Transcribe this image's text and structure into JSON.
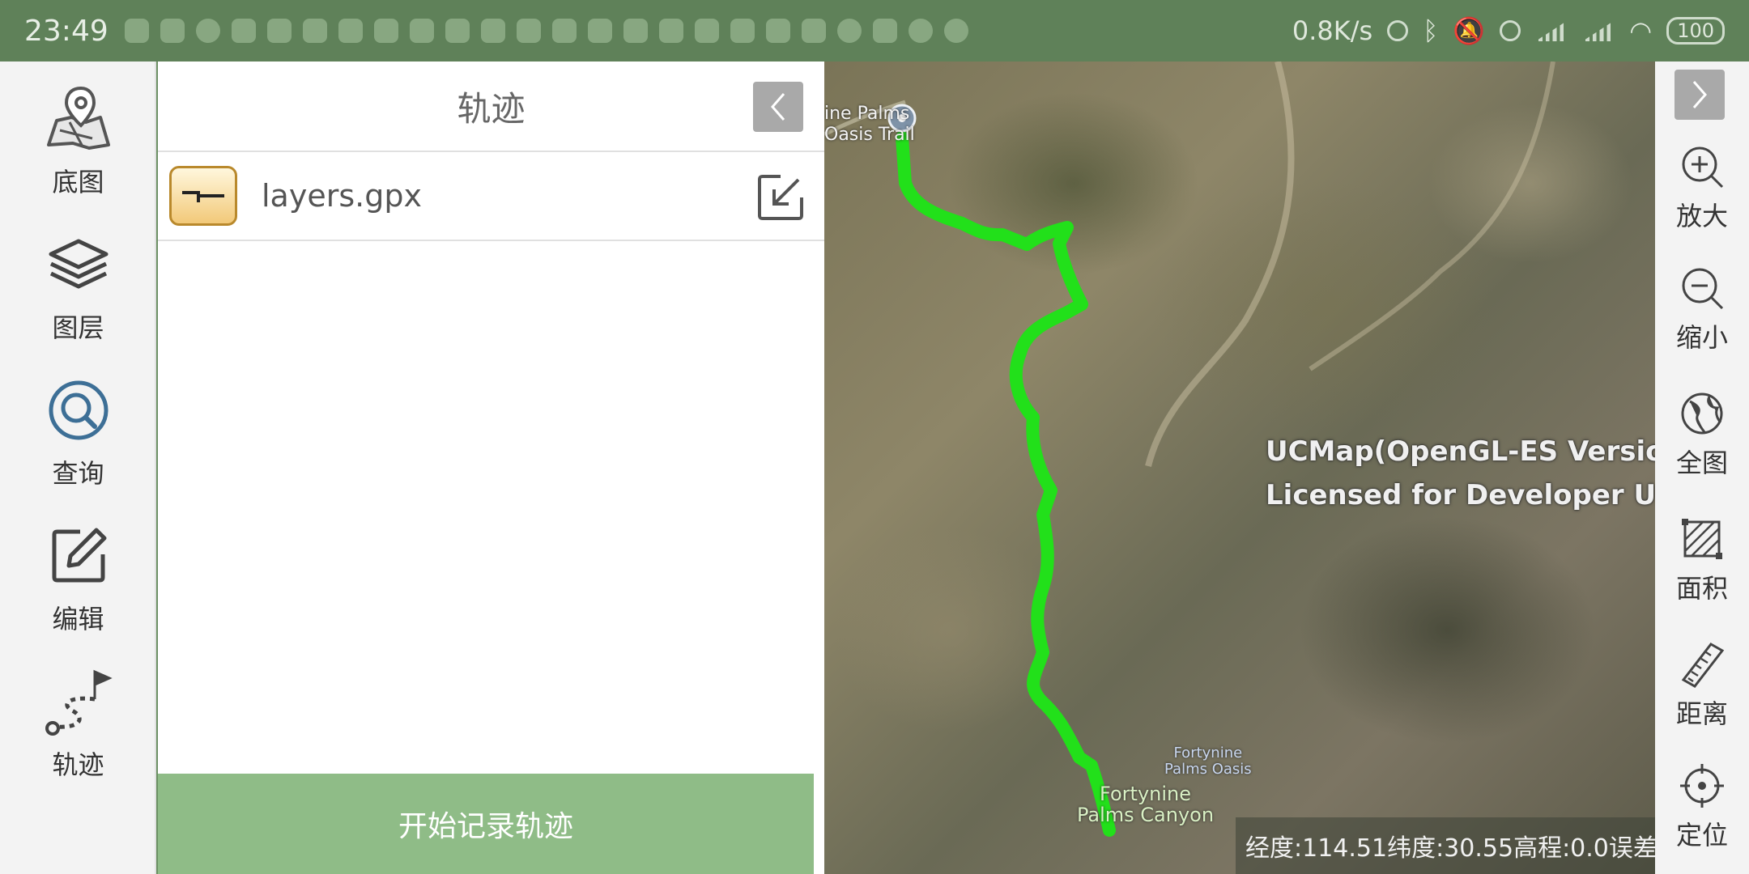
{
  "status_bar": {
    "time": "23:49",
    "speed": "0.8K/s",
    "battery": "100"
  },
  "left_nav": {
    "items": [
      {
        "label": "底图",
        "icon": "map-pin-icon"
      },
      {
        "label": "图层",
        "icon": "layers-icon"
      },
      {
        "label": "查询",
        "icon": "search-icon"
      },
      {
        "label": "编辑",
        "icon": "edit-icon"
      },
      {
        "label": "轨迹",
        "icon": "track-icon"
      }
    ]
  },
  "panel": {
    "title": "轨迹",
    "file": {
      "name": "layers.gpx"
    },
    "record_button": "开始记录轨迹"
  },
  "map": {
    "watermark_line1": "UCMap(OpenGL-ES Version)",
    "watermark_line2": "Licensed for Developer Use",
    "labels": {
      "start_1": "ine Palms",
      "start_2": "Oasis Trail",
      "end_1": "Fortynine",
      "end_2": "Palms Oasis",
      "canyon_1": "Fortynine",
      "canyon_2": "Palms Canyon"
    },
    "coords_text": "经度:114.51纬度:30.55高程:0.0误差",
    "track_color": "#22e01a"
  },
  "right_toolbar": {
    "tools": [
      {
        "label": "放大",
        "icon": "zoom-in-icon"
      },
      {
        "label": "缩小",
        "icon": "zoom-out-icon"
      },
      {
        "label": "全图",
        "icon": "globe-icon"
      },
      {
        "label": "面积",
        "icon": "area-icon"
      },
      {
        "label": "距离",
        "icon": "ruler-icon"
      },
      {
        "label": "定位",
        "icon": "locate-icon"
      }
    ]
  }
}
